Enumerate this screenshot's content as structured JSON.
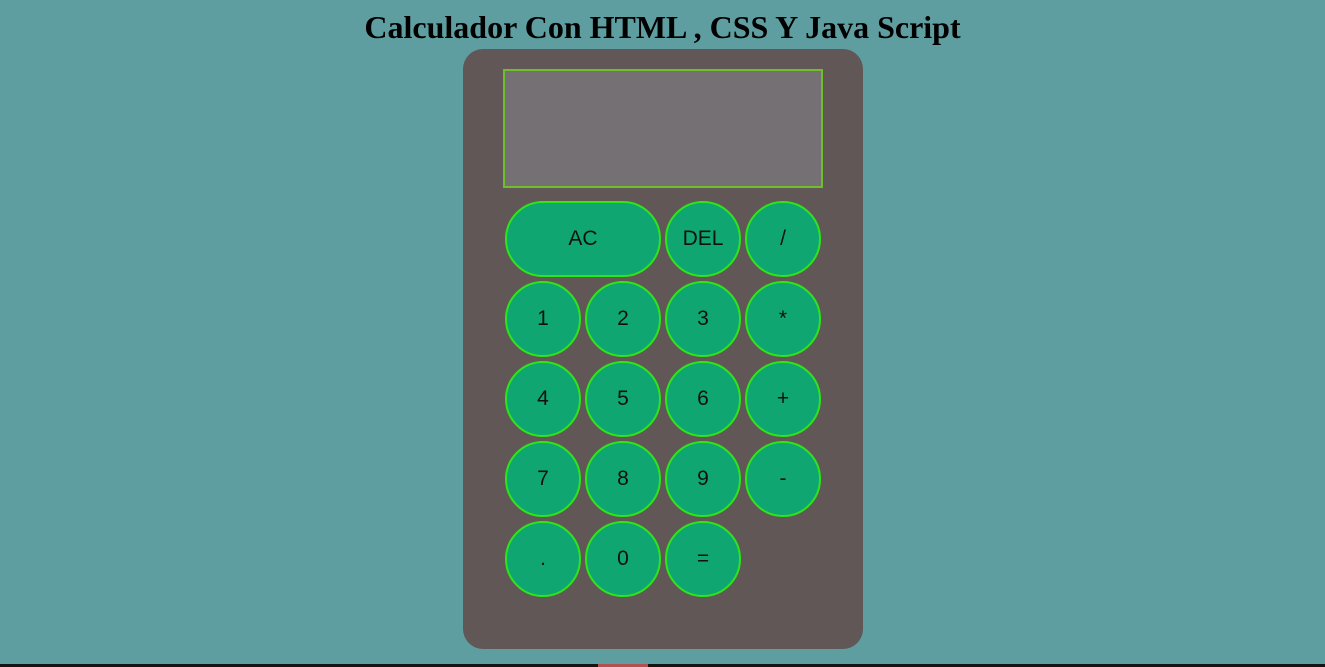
{
  "page": {
    "title": "Calculador Con HTML , CSS Y Java Script"
  },
  "calculator": {
    "display_value": "",
    "keys": [
      {
        "id": "ac",
        "label": "AC"
      },
      {
        "id": "del",
        "label": "DEL"
      },
      {
        "id": "divide",
        "label": "/"
      },
      {
        "id": "1",
        "label": "1"
      },
      {
        "id": "2",
        "label": "2"
      },
      {
        "id": "3",
        "label": "3"
      },
      {
        "id": "multiply",
        "label": "*"
      },
      {
        "id": "4",
        "label": "4"
      },
      {
        "id": "5",
        "label": "5"
      },
      {
        "id": "6",
        "label": "6"
      },
      {
        "id": "plus",
        "label": "+"
      },
      {
        "id": "7",
        "label": "7"
      },
      {
        "id": "8",
        "label": "8"
      },
      {
        "id": "9",
        "label": "9"
      },
      {
        "id": "minus",
        "label": "-"
      },
      {
        "id": "dot",
        "label": "."
      },
      {
        "id": "0",
        "label": "0"
      },
      {
        "id": "equals",
        "label": "="
      }
    ]
  },
  "colors": {
    "page_background": "#5f9ea0",
    "calculator_body": "#615757",
    "display_background": "#757073",
    "display_border": "#6fbf2a",
    "key_fill": "#10a672",
    "key_border": "#2ee51a"
  }
}
